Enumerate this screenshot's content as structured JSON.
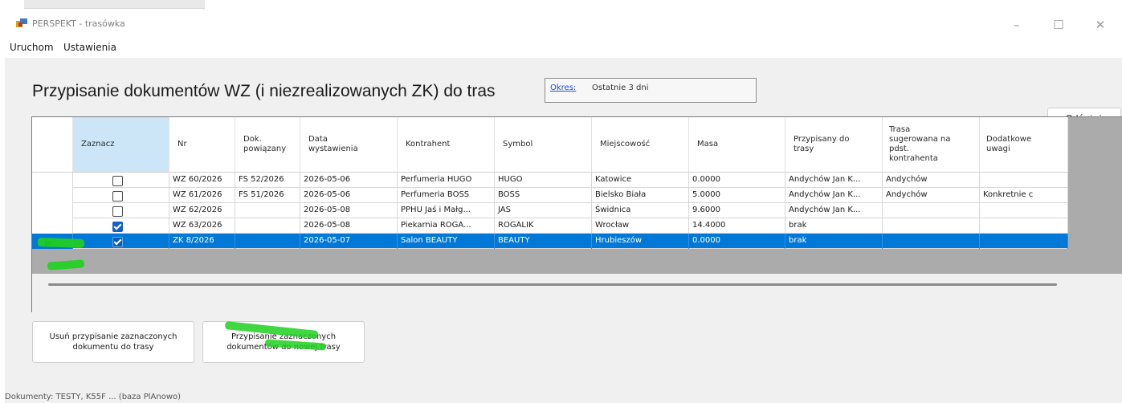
{
  "window": {
    "title": "PERSPEKT - trasówka",
    "minimize_label": "–",
    "maximize_label": "☐",
    "close_label": "✕"
  },
  "menu": {
    "items": [
      "Uruchom",
      "Ustawienia"
    ]
  },
  "header": {
    "title": "Przypisanie dokumentów WZ (i niezrealizowanych ZK) do tras",
    "okres_label": "Okres:",
    "okres_value": "Ostatnie 3 dni",
    "refresh_label": "Odśwież"
  },
  "table": {
    "columns": [
      "Zaznacz",
      "Nr",
      "Dok. powiązany",
      "Data wystawienia",
      "Kontrahent",
      "Symbol",
      "Miejscowość",
      "Masa",
      "Przypisany do trasy",
      "Trasa sugerowana na pdst. kontrahenta",
      "Dodatkowe uwagi"
    ],
    "rows": [
      {
        "checked": false,
        "nr": "WZ 60/2026",
        "dok": "FS 52/2026",
        "data": "2026-05-06",
        "kontrahent": "Perfumeria HUGO",
        "symbol": "HUGO",
        "miejscowosc": "Katowice",
        "masa": "0.0000",
        "trasa": "Andychów Jan K...",
        "sugerowana": "Andychów",
        "uwagi": ""
      },
      {
        "checked": false,
        "nr": "WZ 61/2026",
        "dok": "FS 51/2026",
        "data": "2026-05-06",
        "kontrahent": "Perfumeria BOSS",
        "symbol": "BOSS",
        "miejscowosc": "Bielsko Biała",
        "masa": "5.0000",
        "trasa": "Andychów Jan K...",
        "sugerowana": "Andychów",
        "uwagi": "Konkretnie c"
      },
      {
        "checked": false,
        "nr": "WZ 62/2026",
        "dok": "",
        "data": "2026-05-08",
        "kontrahent": "PPHU Jaś i Małg...",
        "symbol": "JAS",
        "miejscowosc": "Świdnica",
        "masa": "9.6000",
        "trasa": "Andychów Jan K...",
        "sugerowana": "",
        "uwagi": ""
      },
      {
        "checked": true,
        "nr": "WZ 63/2026",
        "dok": "",
        "data": "2026-05-08",
        "kontrahent": "Piekarnia ROGA...",
        "symbol": "ROGALIK",
        "miejscowosc": "Wrocław",
        "masa": "14.4000",
        "trasa": "brak",
        "sugerowana": "",
        "uwagi": ""
      },
      {
        "checked": true,
        "selected": true,
        "nr": "ZK 8/2026",
        "dok": "",
        "data": "2026-05-07",
        "kontrahent": "Salon BEAUTY",
        "symbol": "BEAUTY",
        "miejscowosc": "Hrubieszów",
        "masa": "0.0000",
        "trasa": "brak",
        "sugerowana": "",
        "uwagi": ""
      }
    ]
  },
  "actions": {
    "unassign_label": "Usuń przypisanie zaznaczonych dokumentu do trasy",
    "assign_label": "Przypisanie zaznaczonych dokumentów do nowej trasy"
  },
  "status": {
    "text": "Dokumenty: TESTY, K55F ... (baza PlAnowo)"
  },
  "colors": {
    "selection": "#0078d7",
    "header_selected": "#cde6f7",
    "highlight_marker": "#1fd01f",
    "link": "#1a4fd6"
  }
}
